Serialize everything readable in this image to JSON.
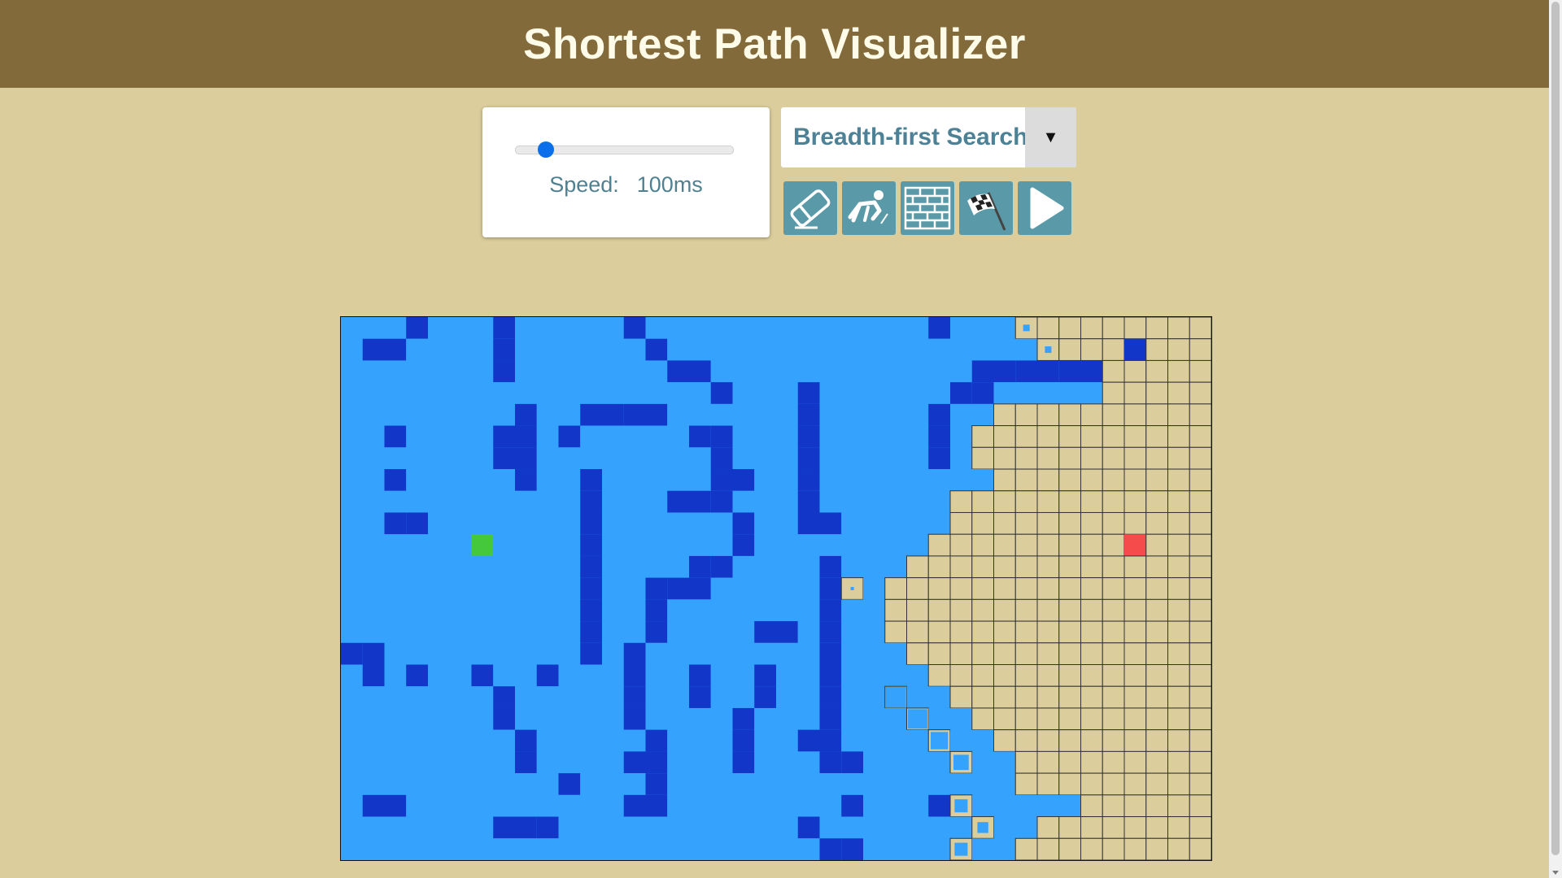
{
  "header": {
    "title": "Shortest Path Visualizer"
  },
  "controls": {
    "speed_label": "Speed:",
    "speed_value": "100ms",
    "speed_fraction": 0.1,
    "algorithm_selected": "Breadth-first Search",
    "tools": [
      {
        "name": "eraser-tool-button",
        "icon": "eraser-icon"
      },
      {
        "name": "start-node-tool-button",
        "icon": "runner-start-icon"
      },
      {
        "name": "wall-tool-button",
        "icon": "brick-wall-icon"
      },
      {
        "name": "finish-node-tool-button",
        "icon": "checkered-flag-icon"
      },
      {
        "name": "run-button",
        "icon": "play-icon"
      }
    ]
  },
  "colors": {
    "header_bg": "#826a3b",
    "page_bg": "#dbcd9c",
    "unvisited": "#dbcd9c",
    "visited": "#35a3fd",
    "wall": "#1136c8",
    "start": "#46c83c",
    "end": "#f54b4b",
    "tool_button": "#5a9aa8"
  },
  "grid": {
    "cols": 40,
    "rows": 25,
    "start": [
      6,
      10
    ],
    "end": [
      36,
      10
    ],
    "frontier": [
      [
        31,
        0
      ],
      [
        32,
        1
      ],
      [
        23,
        12
      ],
      [
        25,
        17
      ],
      [
        26,
        18
      ],
      [
        27,
        19
      ],
      [
        28,
        20
      ],
      [
        28,
        22
      ],
      [
        29,
        23
      ],
      [
        28,
        24
      ]
    ],
    "frontier_sizes": [
      0.3,
      0.3,
      0.15,
      0.95,
      0.9,
      0.8,
      0.7,
      0.6,
      0.5,
      0.6
    ],
    "visited_rows": [
      "1111111111111111111111111111111100000000",
      "1111111111111111111111111111111110000000",
      "1111111111111111111111111111111111100000",
      "1111111111111111111111111111111111100000",
      "1111111111111111111111111111110000000000",
      "1111111111111111111111111111100000000000",
      "1111111111111111111111111111100000000000",
      "1111111111111111111111111111110000000000",
      "1111111111111111111111111111000000000000",
      "1111111111111111111111111111000000000000",
      "1111111111111111111111111110000000000000",
      "1111111111111111111111111100000000000000",
      "1111111111111111111111111000000000000000",
      "1111111111111111111111111000000000000000",
      "1111111111111111111111111000000000000000",
      "1111111111111111111111111100000000000000",
      "1111111111111111111111111110000000000000",
      "1111111111111111111111111111000000000000",
      "1111111111111111111111111111100000000000",
      "1111111111111111111111111111110000000000",
      "1111111111111111111111111111111000000000",
      "1111111111111111111111111111111000000000",
      "1111111111111111111111111111111111000000",
      "1111111111111111111111111111111100000000",
      "1111111111111111111111111111111000000000"
    ],
    "wall_rows": [
      "0001000100000100000000000001000000000000",
      "0110000100000010000000000000000000001000",
      "0000000100000001100000000000011111100000",
      "0000000000000000010001000000110000000000",
      "0000000010011110000001000001000000000000",
      "0010000110100000110001000001000000000000",
      "0000000110000000010001000001000000000000",
      "0010000010010000011001000000000000000000",
      "0000000000010001110001000000000000000000",
      "0011000000010000001001100000000000000000",
      "0000000000010000001000000000000000000000",
      "0000000000010000110000100000000000000000",
      "0000000000010011100000100000000000000000",
      "0000000000010010000000100000000000000000",
      "0000000000010010000110100000000000000000",
      "1100000000010100000000100000000000000000",
      "0101001001000100100100100000000000000000",
      "0000000100000100100100100000000000000000",
      "0000000100000100001000100000000000000000",
      "0000000010000010001001100000000000000000",
      "0000000010000110001000110000000000000000",
      "0000000000100010000000000000000000000000",
      "0110000000000110000000010001000000000000",
      "0000000111000000000001000000000000000000",
      "0000000000000000000000110000000000000000"
    ]
  }
}
